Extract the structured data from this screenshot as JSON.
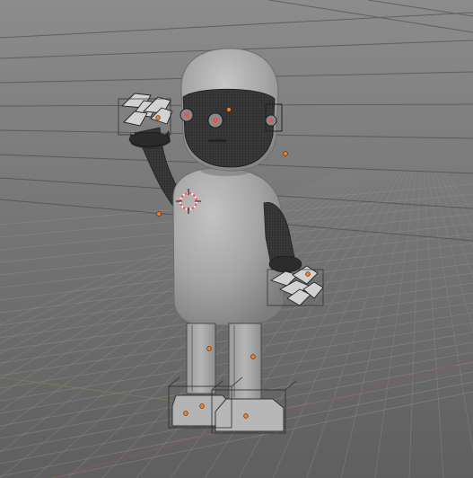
{
  "viewport": {
    "background_top": "#8a8a8a",
    "background_bottom": "#5f5f5f",
    "grid_color": "#8f8f8f",
    "x_axis_color": "#8a5a5a",
    "y_axis_color": "#6d8f56"
  },
  "colors": {
    "body_fill": "#a8a8a8",
    "body_shadow": "#888888",
    "wire_dark": "#2f2f2f",
    "wire_mid": "#555555",
    "origin_point": "#ff7a1a",
    "cursor_red": "#ff5050",
    "eye_red": "#e25a4f",
    "bone_line": "#1f1f1f"
  },
  "icons": {
    "cursor": "3d-cursor-icon"
  }
}
